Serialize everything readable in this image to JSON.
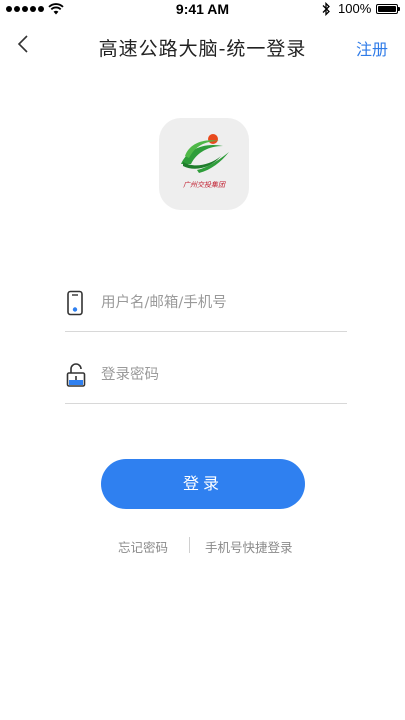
{
  "status_bar": {
    "time": "9:41 AM",
    "battery": "100%"
  },
  "nav": {
    "title": "高速公路大脑-统一登录",
    "register_label": "注册"
  },
  "logo": {
    "caption": "广州交投集团"
  },
  "form": {
    "username_placeholder": "用户名/邮箱/手机号",
    "username_value": "",
    "password_placeholder": "登录密码",
    "password_value": ""
  },
  "actions": {
    "login_label": "登录",
    "forgot_label": "忘记密码",
    "quick_login_label": "手机号快捷登录"
  },
  "colors": {
    "accent": "#2f80f0",
    "register": "#2f7be8",
    "logo_green": "#2e9d3a",
    "logo_red": "#c0192b"
  },
  "icons": {
    "back": "chevron-left-icon",
    "username": "phone-icon",
    "password": "unlock-icon"
  }
}
